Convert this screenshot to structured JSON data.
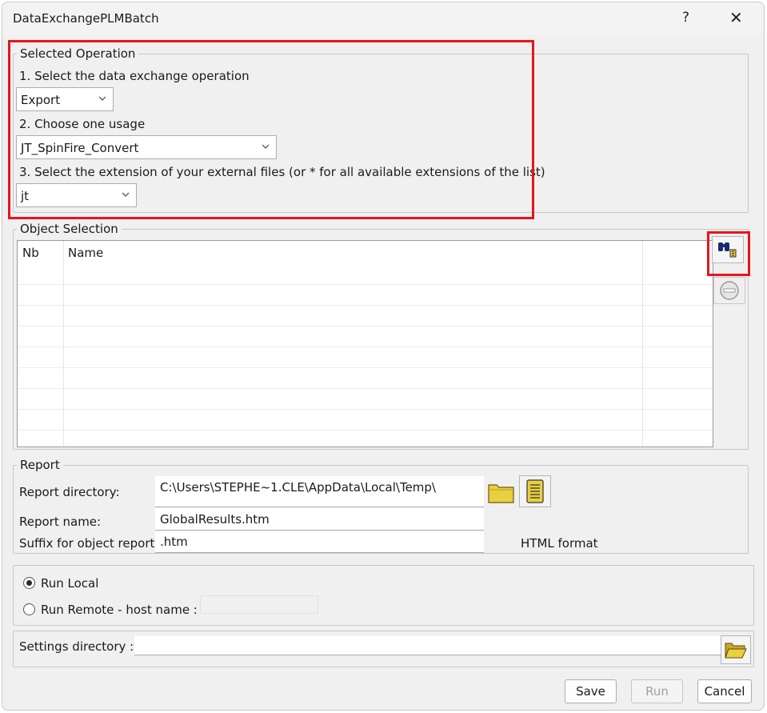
{
  "window": {
    "title": "DataExchangePLMBatch",
    "help_label": "?",
    "close_label": "✕"
  },
  "selected_operation": {
    "legend": "Selected Operation",
    "step1_label": "1. Select the data exchange operation",
    "operation_value": "Export",
    "step2_label": "2. Choose one usage",
    "usage_value": "JT_SpinFire_Convert",
    "step3_label": "3. Select the extension of your external files (or * for all available extensions of the list)",
    "extension_value": "jt"
  },
  "object_selection": {
    "legend": "Object Selection",
    "columns": [
      "Nb",
      "Name"
    ],
    "rows": [],
    "search_button_icon": "binoculars-icon",
    "remove_button_icon": "remove-icon"
  },
  "report": {
    "legend": "Report",
    "directory_label": "Report directory:",
    "directory_value": "C:\\Users\\STEPHE~1.CLE\\AppData\\Local\\Temp\\",
    "name_label": "Report name:",
    "name_value": "GlobalResults.htm",
    "suffix_label": "Suffix for object report:",
    "suffix_value": ".htm",
    "format_label": "HTML format",
    "browse_icon": "folder-icon",
    "view_icon": "scroll-icon"
  },
  "run": {
    "local_label": "Run Local",
    "remote_label": "Run Remote - host name :",
    "selected": "local",
    "host_value": ""
  },
  "settings": {
    "label": "Settings directory :",
    "value": "",
    "browse_icon": "open-folder-icon"
  },
  "footer": {
    "save_label": "Save",
    "run_label": "Run",
    "cancel_label": "Cancel"
  },
  "colors": {
    "highlight": "#e8141c",
    "folder": "#e8d040"
  }
}
